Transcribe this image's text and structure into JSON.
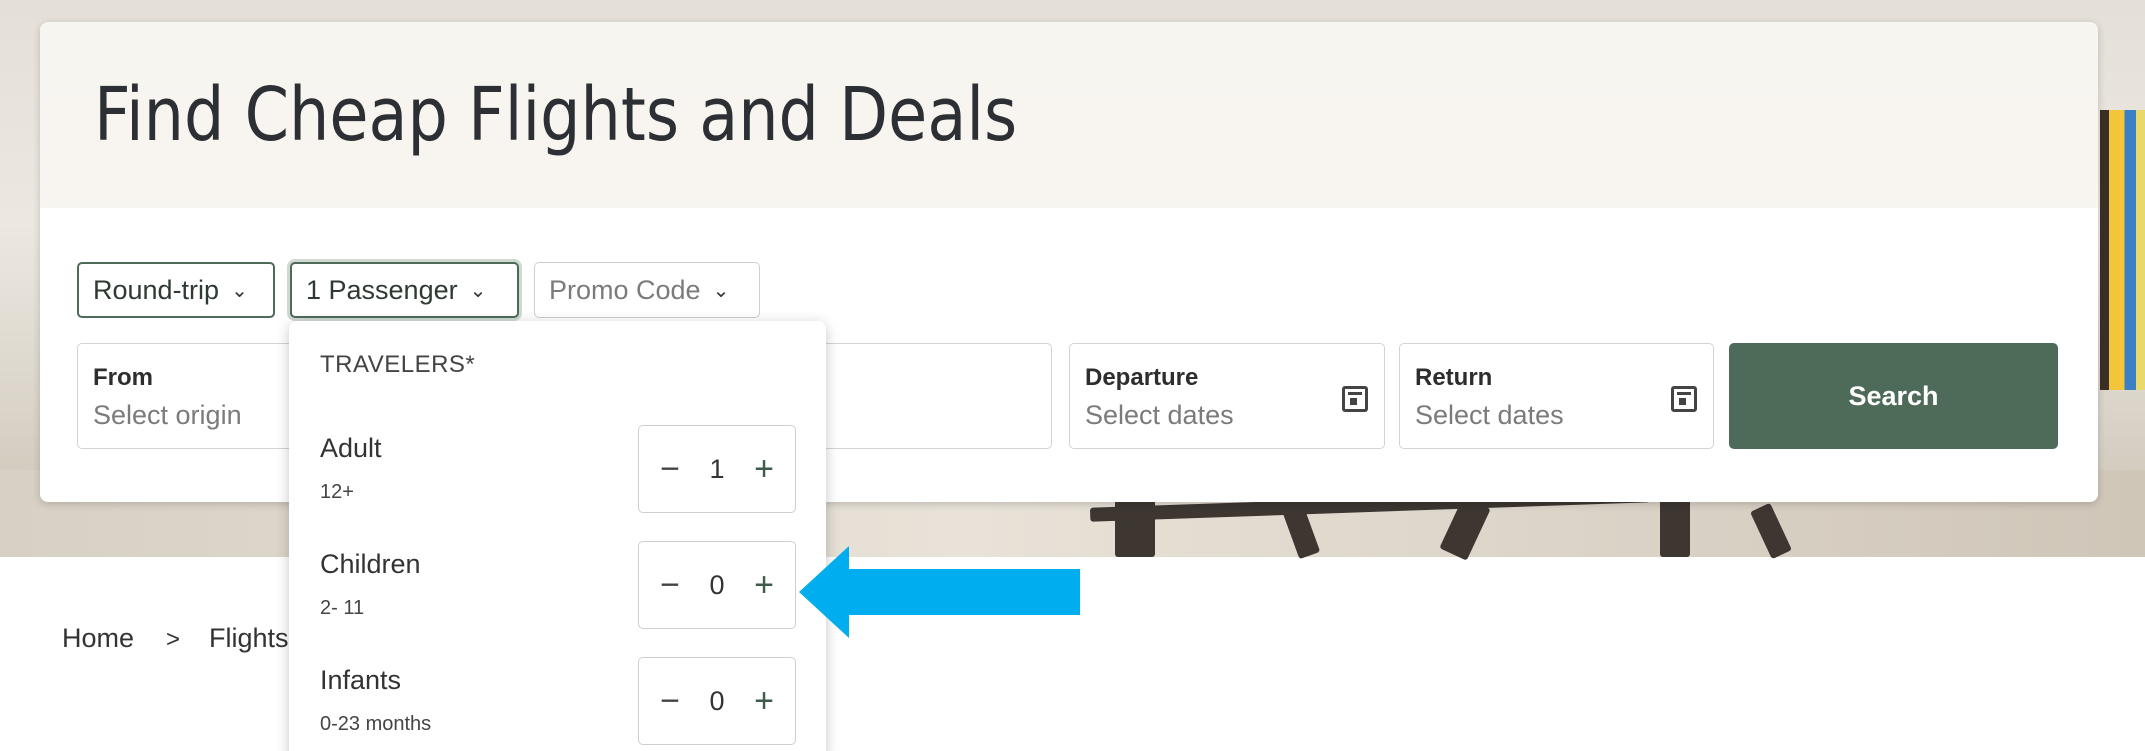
{
  "header": {
    "title": "Find Cheap Flights and Deals"
  },
  "trip_options": {
    "trip_type": "Round-trip",
    "passengers": "1 Passenger",
    "promo": "Promo Code"
  },
  "fields": {
    "from": {
      "label": "From",
      "placeholder": "Select origin"
    },
    "departure": {
      "label": "Departure",
      "placeholder": "Select dates"
    },
    "return": {
      "label": "Return",
      "placeholder": "Select dates"
    }
  },
  "search": {
    "label": "Search"
  },
  "breadcrumb": [
    "Home",
    ">",
    "Flights"
  ],
  "travelers": {
    "title": "TRAVELERS*",
    "rows": [
      {
        "label": "Adult",
        "sub": "12+",
        "count": "1"
      },
      {
        "label": "Children",
        "sub": "2- 11",
        "count": "0"
      },
      {
        "label": "Infants",
        "sub": "0-23 months",
        "count": "0"
      }
    ],
    "minus": "−",
    "plus": "+"
  },
  "colors": {
    "brand": "#4e6b59",
    "arrow": "#00aef0"
  }
}
